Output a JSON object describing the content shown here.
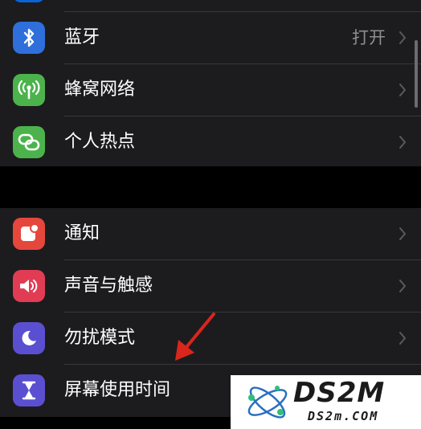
{
  "groups": [
    {
      "rows": [
        {
          "label": "",
          "icon": "partial-top-icon",
          "color": "#0a64d6"
        },
        {
          "label": "蓝牙",
          "value": "打开",
          "icon": "bluetooth-icon",
          "color": "#2f6fdc"
        },
        {
          "label": "蜂窝网络",
          "icon": "cellular-antenna-icon",
          "color": "#4cb34c"
        },
        {
          "label": "个人热点",
          "icon": "personal-hotspot-icon",
          "color": "#4cb34c"
        }
      ]
    },
    {
      "rows": [
        {
          "label": "通知",
          "icon": "notifications-icon",
          "color": "#e5473d"
        },
        {
          "label": "声音与触感",
          "icon": "speaker-icon",
          "color": "#e23c54"
        },
        {
          "label": "勿扰模式",
          "icon": "moon-icon",
          "color": "#5b4fd1"
        },
        {
          "label": "屏幕使用时间",
          "icon": "hourglass-icon",
          "color": "#5b4fd1"
        }
      ]
    }
  ],
  "watermark": {
    "title": "DS2M",
    "subtitle": "DS2m.COM"
  },
  "annotation": {
    "icon": "red-arrow-icon",
    "color": "#d9261c"
  }
}
